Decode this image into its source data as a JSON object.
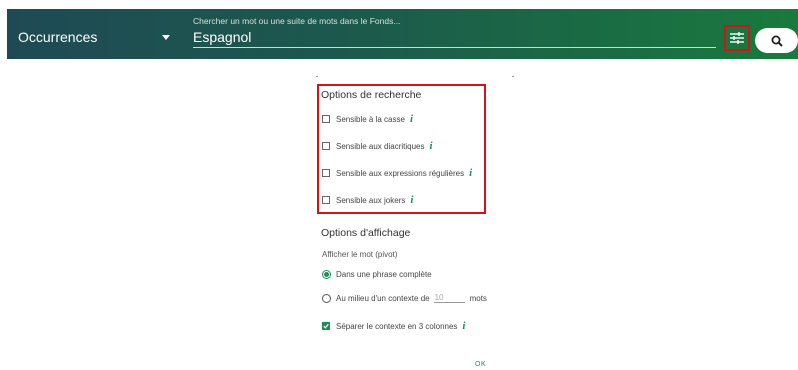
{
  "header": {
    "mode_select": "Occurrences",
    "search_label": "Chercher un mot ou une suite de mots dans le Fonds...",
    "search_value": "Espagnol"
  },
  "icons": {
    "filter": "tune-sliders-icon",
    "search": "magnifier-icon"
  },
  "colors": {
    "accent": "#1e8e5a",
    "highlight": "#d1141a"
  },
  "search_options": {
    "title": "Options de recherche",
    "items": [
      {
        "label": "Sensible à la casse",
        "checked": false
      },
      {
        "label": "Sensible aux diacritiques",
        "checked": false
      },
      {
        "label": "Sensible aux expressions régulières",
        "checked": false
      },
      {
        "label": "Sensible aux jokers",
        "checked": false
      }
    ]
  },
  "display_options": {
    "title": "Options d'affichage",
    "pivot_label": "Afficher le mot (pivot)",
    "radio_full_sentence": "Dans une phrase complète",
    "radio_context_prefix": "Au milieu d'un contexte de",
    "context_placeholder": "10",
    "radio_context_suffix": "mots",
    "split_columns": "Séparer le contexte en 3 colonnes",
    "split_checked": true
  },
  "ok_label": "OK"
}
